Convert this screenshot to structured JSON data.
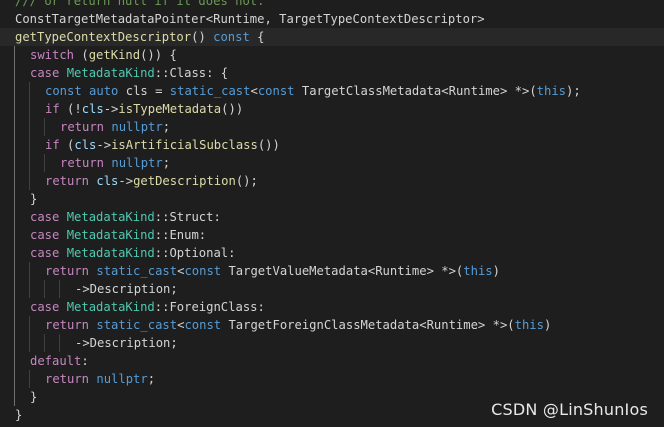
{
  "editor": {
    "colors": {
      "background": "#1e1e1e",
      "keyword": "#569cd6",
      "control": "#c586c0",
      "type": "#4ec9b0",
      "function": "#dcdcaa",
      "variable": "#9cdcfe",
      "text": "#d4d4d4",
      "comment": "#6a9955"
    },
    "lines": [
      {
        "indent": 0,
        "tokens": [
          {
            "t": "/// or return null if it does not.",
            "c": "cmt"
          }
        ]
      },
      {
        "indent": 0,
        "tokens": [
          {
            "t": "ConstTargetMetadataPointer<Runtime, TargetTypeContextDescriptor>",
            "c": "txt"
          }
        ]
      },
      {
        "indent": 0,
        "highlight": true,
        "tokens": [
          {
            "t": "getTypeContextDescriptor",
            "c": "fn"
          },
          {
            "t": "() ",
            "c": "txt"
          },
          {
            "t": "const",
            "c": "kw"
          },
          {
            "t": " {",
            "c": "txt"
          }
        ]
      },
      {
        "indent": 1,
        "tokens": [
          {
            "t": "switch",
            "c": "ctl"
          },
          {
            "t": " (",
            "c": "txt"
          },
          {
            "t": "getKind",
            "c": "fn"
          },
          {
            "t": "()) {",
            "c": "txt"
          }
        ]
      },
      {
        "indent": 1,
        "tokens": [
          {
            "t": "case",
            "c": "ctl"
          },
          {
            "t": " ",
            "c": "txt"
          },
          {
            "t": "MetadataKind",
            "c": "type"
          },
          {
            "t": "::Class: {",
            "c": "txt"
          }
        ]
      },
      {
        "indent": 2,
        "tokens": [
          {
            "t": "const",
            "c": "kw"
          },
          {
            "t": " ",
            "c": "txt"
          },
          {
            "t": "auto",
            "c": "kw"
          },
          {
            "t": " cls = ",
            "c": "txt"
          },
          {
            "t": "static_cast",
            "c": "kw"
          },
          {
            "t": "<",
            "c": "txt"
          },
          {
            "t": "const",
            "c": "kw"
          },
          {
            "t": " TargetClassMetadata<Runtime> *>(",
            "c": "txt"
          },
          {
            "t": "this",
            "c": "kw"
          },
          {
            "t": ");",
            "c": "txt"
          }
        ]
      },
      {
        "indent": 2,
        "tokens": [
          {
            "t": "if",
            "c": "ctl"
          },
          {
            "t": " (!",
            "c": "txt"
          },
          {
            "t": "cls",
            "c": "var"
          },
          {
            "t": "->",
            "c": "txt"
          },
          {
            "t": "isTypeMetadata",
            "c": "fn"
          },
          {
            "t": "())",
            "c": "txt"
          }
        ]
      },
      {
        "indent": 3,
        "tokens": [
          {
            "t": "return",
            "c": "ctl"
          },
          {
            "t": " ",
            "c": "txt"
          },
          {
            "t": "nullptr",
            "c": "kw"
          },
          {
            "t": ";",
            "c": "txt"
          }
        ]
      },
      {
        "indent": 2,
        "tokens": [
          {
            "t": "if",
            "c": "ctl"
          },
          {
            "t": " (",
            "c": "txt"
          },
          {
            "t": "cls",
            "c": "var"
          },
          {
            "t": "->",
            "c": "txt"
          },
          {
            "t": "isArtificialSubclass",
            "c": "fn"
          },
          {
            "t": "())",
            "c": "txt"
          }
        ]
      },
      {
        "indent": 3,
        "tokens": [
          {
            "t": "return",
            "c": "ctl"
          },
          {
            "t": " ",
            "c": "txt"
          },
          {
            "t": "nullptr",
            "c": "kw"
          },
          {
            "t": ";",
            "c": "txt"
          }
        ]
      },
      {
        "indent": 2,
        "tokens": [
          {
            "t": "return",
            "c": "ctl"
          },
          {
            "t": " ",
            "c": "txt"
          },
          {
            "t": "cls",
            "c": "var"
          },
          {
            "t": "->",
            "c": "txt"
          },
          {
            "t": "getDescription",
            "c": "fn"
          },
          {
            "t": "();",
            "c": "txt"
          }
        ]
      },
      {
        "indent": 1,
        "tokens": [
          {
            "t": "}",
            "c": "txt"
          }
        ]
      },
      {
        "indent": 1,
        "tokens": [
          {
            "t": "case",
            "c": "ctl"
          },
          {
            "t": " ",
            "c": "txt"
          },
          {
            "t": "MetadataKind",
            "c": "type"
          },
          {
            "t": "::Struct:",
            "c": "txt"
          }
        ]
      },
      {
        "indent": 1,
        "tokens": [
          {
            "t": "case",
            "c": "ctl"
          },
          {
            "t": " ",
            "c": "txt"
          },
          {
            "t": "MetadataKind",
            "c": "type"
          },
          {
            "t": "::Enum:",
            "c": "txt"
          }
        ]
      },
      {
        "indent": 1,
        "tokens": [
          {
            "t": "case",
            "c": "ctl"
          },
          {
            "t": " ",
            "c": "txt"
          },
          {
            "t": "MetadataKind",
            "c": "type"
          },
          {
            "t": "::Optional:",
            "c": "txt"
          }
        ]
      },
      {
        "indent": 2,
        "tokens": [
          {
            "t": "return",
            "c": "ctl"
          },
          {
            "t": " ",
            "c": "txt"
          },
          {
            "t": "static_cast",
            "c": "kw"
          },
          {
            "t": "<",
            "c": "txt"
          },
          {
            "t": "const",
            "c": "kw"
          },
          {
            "t": " TargetValueMetadata<Runtime> *>(",
            "c": "txt"
          },
          {
            "t": "this",
            "c": "kw"
          },
          {
            "t": ")",
            "c": "txt"
          }
        ]
      },
      {
        "indent": 4,
        "tokens": [
          {
            "t": "->Description;",
            "c": "txt"
          }
        ]
      },
      {
        "indent": 1,
        "tokens": [
          {
            "t": "case",
            "c": "ctl"
          },
          {
            "t": " ",
            "c": "txt"
          },
          {
            "t": "MetadataKind",
            "c": "type"
          },
          {
            "t": "::ForeignClass:",
            "c": "txt"
          }
        ]
      },
      {
        "indent": 2,
        "tokens": [
          {
            "t": "return",
            "c": "ctl"
          },
          {
            "t": " ",
            "c": "txt"
          },
          {
            "t": "static_cast",
            "c": "kw"
          },
          {
            "t": "<",
            "c": "txt"
          },
          {
            "t": "const",
            "c": "kw"
          },
          {
            "t": " TargetForeignClassMetadata<Runtime> *>(",
            "c": "txt"
          },
          {
            "t": "this",
            "c": "kw"
          },
          {
            "t": ")",
            "c": "txt"
          }
        ]
      },
      {
        "indent": 4,
        "tokens": [
          {
            "t": "->Description;",
            "c": "txt"
          }
        ]
      },
      {
        "indent": 1,
        "tokens": [
          {
            "t": "default",
            "c": "ctl"
          },
          {
            "t": ":",
            "c": "txt"
          }
        ]
      },
      {
        "indent": 2,
        "tokens": [
          {
            "t": "return",
            "c": "ctl"
          },
          {
            "t": " ",
            "c": "txt"
          },
          {
            "t": "nullptr",
            "c": "kw"
          },
          {
            "t": ";",
            "c": "txt"
          }
        ]
      },
      {
        "indent": 1,
        "tokens": [
          {
            "t": "}",
            "c": "txt"
          }
        ]
      },
      {
        "indent": 0,
        "tokens": [
          {
            "t": "}",
            "c": "txt"
          }
        ]
      }
    ]
  },
  "watermark": "CSDN @LinShunIos"
}
